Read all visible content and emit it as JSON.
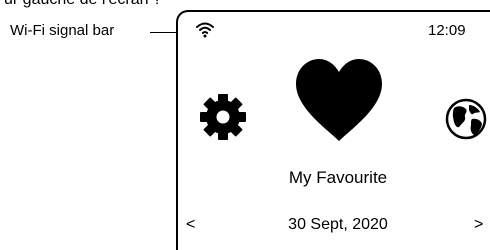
{
  "caption": {
    "top_text": "ur gauche de l'écran ?"
  },
  "callout": {
    "label": "Wi-Fi signal bar"
  },
  "status_bar": {
    "time": "12:09",
    "wifi_icon": "wifi-icon"
  },
  "home": {
    "left_icon": "gear-icon",
    "center_icon": "heart-icon",
    "right_icon": "globe-icon",
    "selected_label": "My Favourite"
  },
  "footer": {
    "prev_label": "<",
    "date": "30 Sept, 2020",
    "next_label": ">"
  }
}
